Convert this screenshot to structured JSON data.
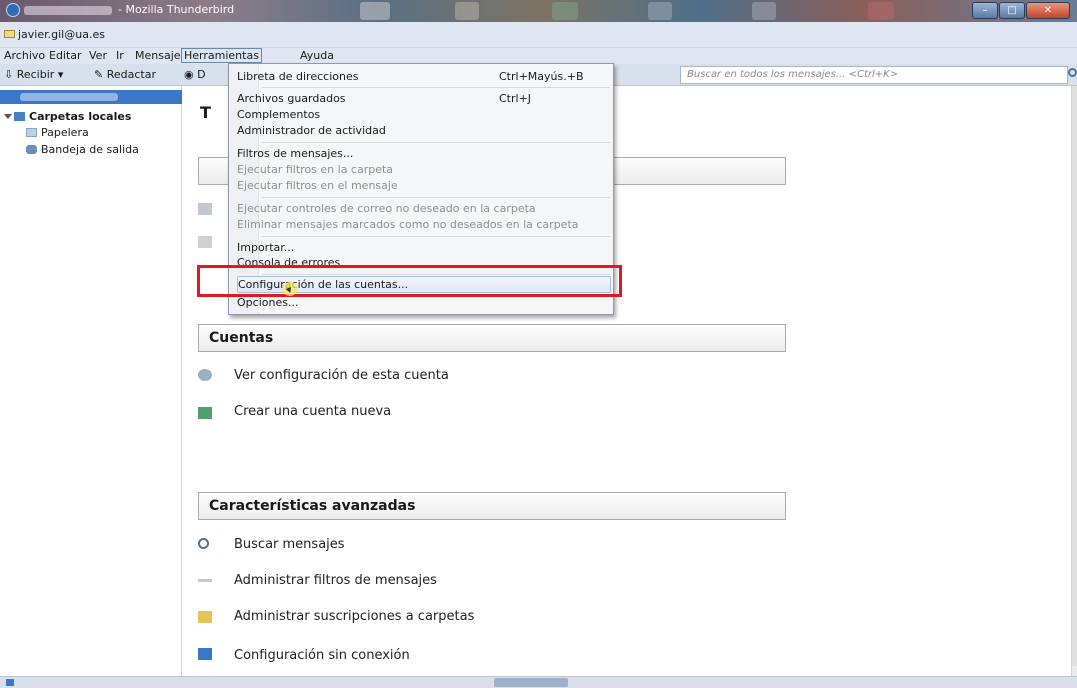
{
  "window": {
    "title": "- Mozilla Thunderbird",
    "account_label": "javier.gil@ua.es"
  },
  "menubar": [
    "Archivo",
    "Editar",
    "Ver",
    "Ir",
    "Mensaje",
    "Herramientas",
    "Ayuda"
  ],
  "toolbar": {
    "receive_label": "Recibir",
    "compose_label": "Redactar",
    "address_label": "D",
    "search_placeholder": "Buscar en todos los mensajes... <Ctrl+K>"
  },
  "folders": {
    "local_folders": "Carpetas locales",
    "trash": "Papelera",
    "outbox": "Bandeja de salida"
  },
  "main": {
    "title_initial": "T",
    "accounts_heading": "Cuentas",
    "view_account_settings": "Ver configuración de esta cuenta",
    "create_account": "Crear una cuenta nueva",
    "advanced_heading": "Características avanzadas",
    "search_messages": "Buscar mensajes",
    "manage_filters": "Administrar filtros de mensajes",
    "manage_subscriptions": "Administrar suscripciones a carpetas",
    "offline_settings": "Configuración sin conexión"
  },
  "tools_menu": {
    "items": [
      {
        "label": "Libreta de direcciones",
        "accel": "Ctrl+Mayús.+B",
        "disabled": false
      },
      {
        "label": "Archivos guardados",
        "accel": "Ctrl+J",
        "disabled": false
      },
      {
        "label": "Complementos",
        "accel": "",
        "disabled": false
      },
      {
        "label": "Administrador de actividad",
        "accel": "",
        "disabled": false
      },
      {
        "label": "Filtros de mensajes...",
        "accel": "",
        "disabled": false
      },
      {
        "label": "Ejecutar filtros en la carpeta",
        "accel": "",
        "disabled": true
      },
      {
        "label": "Ejecutar filtros en el mensaje",
        "accel": "",
        "disabled": true
      },
      {
        "label": "Ejecutar controles de correo no deseado en la carpeta",
        "accel": "",
        "disabled": true
      },
      {
        "label": "Eliminar mensajes marcados como no deseados en la carpeta",
        "accel": "",
        "disabled": true
      },
      {
        "label": "Importar...",
        "accel": "",
        "disabled": false
      },
      {
        "label": "Consola de errores",
        "accel": "",
        "disabled": false
      },
      {
        "label": "Configuración de las cuentas...",
        "accel": "",
        "disabled": false
      },
      {
        "label": "Opciones...",
        "accel": "",
        "disabled": false
      }
    ]
  },
  "colors": {
    "accent": "#3b77c9",
    "highlight_box": "#e0191f",
    "menu_bg": "#f5f6f7"
  }
}
